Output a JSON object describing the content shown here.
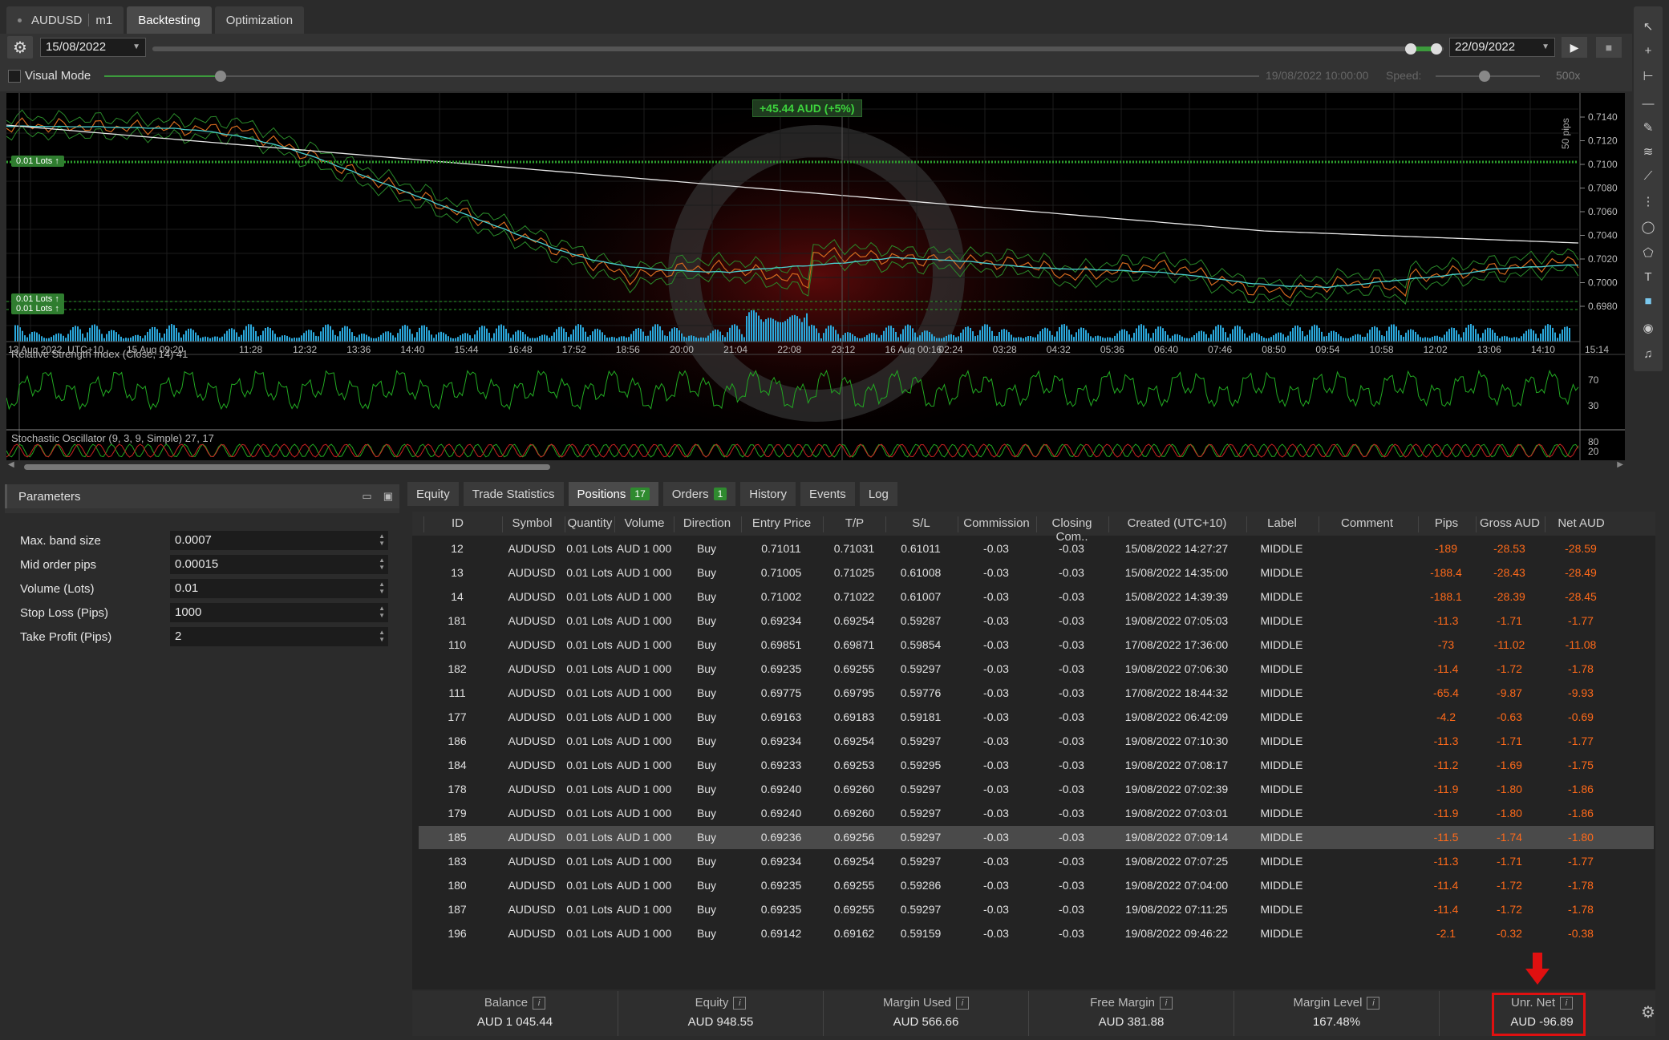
{
  "top_tabs": {
    "symbol": "AUDUSD",
    "timeframe": "m1",
    "backtesting": "Backtesting",
    "optimization": "Optimization"
  },
  "controls": {
    "start_date": "15/08/2022",
    "end_date": "22/09/2022",
    "visual_mode": "Visual Mode",
    "current_time": "19/08/2022 10:00:00",
    "speed_label": "Speed:",
    "speed_value": "500x"
  },
  "chart": {
    "pnl_badge": "+45.44 AUD (+5%)",
    "lots_tags": [
      "0.01 Lots",
      "0.01 Lots",
      "0.01 Lots"
    ],
    "pips_label": "50 pips",
    "price_ticks": [
      "0.7140",
      "0.7120",
      "0.7100",
      "0.7080",
      "0.7060",
      "0.7040",
      "0.7020",
      "0.7000",
      "0.6980"
    ],
    "time_ticks": [
      "13 Aug 2022, UTC+10",
      "15 Aug 09:20",
      "11:28",
      "12:32",
      "13:36",
      "14:40",
      "15:44",
      "16:48",
      "17:52",
      "18:56",
      "20:00",
      "21:04",
      "22:08",
      "23:12",
      "16 Aug 00:16",
      "02:24",
      "03:28",
      "04:32",
      "05:36",
      "06:40",
      "07:46",
      "08:50",
      "09:54",
      "10:58",
      "12:02",
      "13:06",
      "14:10",
      "15:14"
    ],
    "rsi_label": "Relative Strength Index (Close, 14) 41",
    "rsi_ticks": [
      "70",
      "30"
    ],
    "stoch_label": "Stochastic Oscillator (9, 3, 9, Simple) 27, 17",
    "stoch_ticks": [
      "80",
      "20"
    ]
  },
  "parameters": {
    "title": "Parameters",
    "rows": [
      {
        "label": "Max. band size",
        "value": "0.0007"
      },
      {
        "label": "Mid order pips",
        "value": "0.00015"
      },
      {
        "label": "Volume (Lots)",
        "value": "0.01"
      },
      {
        "label": "Stop Loss (Pips)",
        "value": "1000"
      },
      {
        "label": "Take Profit (Pips)",
        "value": "2"
      }
    ]
  },
  "panel_tabs": {
    "equity": "Equity",
    "trade_statistics": "Trade Statistics",
    "positions": "Positions",
    "positions_count": "17",
    "orders": "Orders",
    "orders_count": "1",
    "history": "History",
    "events": "Events",
    "log": "Log"
  },
  "columns": [
    "ID",
    "Symbol",
    "Quantity",
    "Volume",
    "Direction",
    "Entry Price",
    "T/P",
    "S/L",
    "Commission",
    "Closing Com..",
    "Created (UTC+10)",
    "Label",
    "Comment",
    "Pips",
    "Gross AUD",
    "Net AUD"
  ],
  "rows": [
    [
      "12",
      "AUDUSD",
      "0.01 Lots",
      "AUD 1 000",
      "Buy",
      "0.71011",
      "0.71031",
      "0.61011",
      "-0.03",
      "-0.03",
      "15/08/2022 14:27:27",
      "MIDDLE",
      "",
      "-189",
      "-28.53",
      "-28.59"
    ],
    [
      "13",
      "AUDUSD",
      "0.01 Lots",
      "AUD 1 000",
      "Buy",
      "0.71005",
      "0.71025",
      "0.61008",
      "-0.03",
      "-0.03",
      "15/08/2022 14:35:00",
      "MIDDLE",
      "",
      "-188.4",
      "-28.43",
      "-28.49"
    ],
    [
      "14",
      "AUDUSD",
      "0.01 Lots",
      "AUD 1 000",
      "Buy",
      "0.71002",
      "0.71022",
      "0.61007",
      "-0.03",
      "-0.03",
      "15/08/2022 14:39:39",
      "MIDDLE",
      "",
      "-188.1",
      "-28.39",
      "-28.45"
    ],
    [
      "181",
      "AUDUSD",
      "0.01 Lots",
      "AUD 1 000",
      "Buy",
      "0.69234",
      "0.69254",
      "0.59287",
      "-0.03",
      "-0.03",
      "19/08/2022 07:05:03",
      "MIDDLE",
      "",
      "-11.3",
      "-1.71",
      "-1.77"
    ],
    [
      "110",
      "AUDUSD",
      "0.01 Lots",
      "AUD 1 000",
      "Buy",
      "0.69851",
      "0.69871",
      "0.59854",
      "-0.03",
      "-0.03",
      "17/08/2022 17:36:00",
      "MIDDLE",
      "",
      "-73",
      "-11.02",
      "-11.08"
    ],
    [
      "182",
      "AUDUSD",
      "0.01 Lots",
      "AUD 1 000",
      "Buy",
      "0.69235",
      "0.69255",
      "0.59297",
      "-0.03",
      "-0.03",
      "19/08/2022 07:06:30",
      "MIDDLE",
      "",
      "-11.4",
      "-1.72",
      "-1.78"
    ],
    [
      "111",
      "AUDUSD",
      "0.01 Lots",
      "AUD 1 000",
      "Buy",
      "0.69775",
      "0.69795",
      "0.59776",
      "-0.03",
      "-0.03",
      "17/08/2022 18:44:32",
      "MIDDLE",
      "",
      "-65.4",
      "-9.87",
      "-9.93"
    ],
    [
      "177",
      "AUDUSD",
      "0.01 Lots",
      "AUD 1 000",
      "Buy",
      "0.69163",
      "0.69183",
      "0.59181",
      "-0.03",
      "-0.03",
      "19/08/2022 06:42:09",
      "MIDDLE",
      "",
      "-4.2",
      "-0.63",
      "-0.69"
    ],
    [
      "186",
      "AUDUSD",
      "0.01 Lots",
      "AUD 1 000",
      "Buy",
      "0.69234",
      "0.69254",
      "0.59297",
      "-0.03",
      "-0.03",
      "19/08/2022 07:10:30",
      "MIDDLE",
      "",
      "-11.3",
      "-1.71",
      "-1.77"
    ],
    [
      "184",
      "AUDUSD",
      "0.01 Lots",
      "AUD 1 000",
      "Buy",
      "0.69233",
      "0.69253",
      "0.59295",
      "-0.03",
      "-0.03",
      "19/08/2022 07:08:17",
      "MIDDLE",
      "",
      "-11.2",
      "-1.69",
      "-1.75"
    ],
    [
      "178",
      "AUDUSD",
      "0.01 Lots",
      "AUD 1 000",
      "Buy",
      "0.69240",
      "0.69260",
      "0.59297",
      "-0.03",
      "-0.03",
      "19/08/2022 07:02:39",
      "MIDDLE",
      "",
      "-11.9",
      "-1.80",
      "-1.86"
    ],
    [
      "179",
      "AUDUSD",
      "0.01 Lots",
      "AUD 1 000",
      "Buy",
      "0.69240",
      "0.69260",
      "0.59297",
      "-0.03",
      "-0.03",
      "19/08/2022 07:03:01",
      "MIDDLE",
      "",
      "-11.9",
      "-1.80",
      "-1.86"
    ],
    [
      "185",
      "AUDUSD",
      "0.01 Lots",
      "AUD 1 000",
      "Buy",
      "0.69236",
      "0.69256",
      "0.59297",
      "-0.03",
      "-0.03",
      "19/08/2022 07:09:14",
      "MIDDLE",
      "",
      "-11.5",
      "-1.74",
      "-1.80"
    ],
    [
      "183",
      "AUDUSD",
      "0.01 Lots",
      "AUD 1 000",
      "Buy",
      "0.69234",
      "0.69254",
      "0.59297",
      "-0.03",
      "-0.03",
      "19/08/2022 07:07:25",
      "MIDDLE",
      "",
      "-11.3",
      "-1.71",
      "-1.77"
    ],
    [
      "180",
      "AUDUSD",
      "0.01 Lots",
      "AUD 1 000",
      "Buy",
      "0.69235",
      "0.69255",
      "0.59286",
      "-0.03",
      "-0.03",
      "19/08/2022 07:04:00",
      "MIDDLE",
      "",
      "-11.4",
      "-1.72",
      "-1.78"
    ],
    [
      "187",
      "AUDUSD",
      "0.01 Lots",
      "AUD 1 000",
      "Buy",
      "0.69235",
      "0.69255",
      "0.59297",
      "-0.03",
      "-0.03",
      "19/08/2022 07:11:25",
      "MIDDLE",
      "",
      "-11.4",
      "-1.72",
      "-1.78"
    ],
    [
      "196",
      "AUDUSD",
      "0.01 Lots",
      "AUD 1 000",
      "Buy",
      "0.69142",
      "0.69162",
      "0.59159",
      "-0.03",
      "-0.03",
      "19/08/2022 09:46:22",
      "MIDDLE",
      "",
      "-2.1",
      "-0.32",
      "-0.38"
    ]
  ],
  "selected_row": 12,
  "footer": [
    {
      "label": "Balance",
      "value": "AUD 1 045.44"
    },
    {
      "label": "Equity",
      "value": "AUD 948.55"
    },
    {
      "label": "Margin Used",
      "value": "AUD 566.66"
    },
    {
      "label": "Free Margin",
      "value": "AUD 381.88"
    },
    {
      "label": "Margin Level",
      "value": "167.48%"
    },
    {
      "label": "Unr. Net",
      "value": "AUD -96.89"
    }
  ],
  "colors": {
    "accent": "#2f8a2f",
    "negative": "#ff6a1a",
    "highlight": "#e01010"
  }
}
